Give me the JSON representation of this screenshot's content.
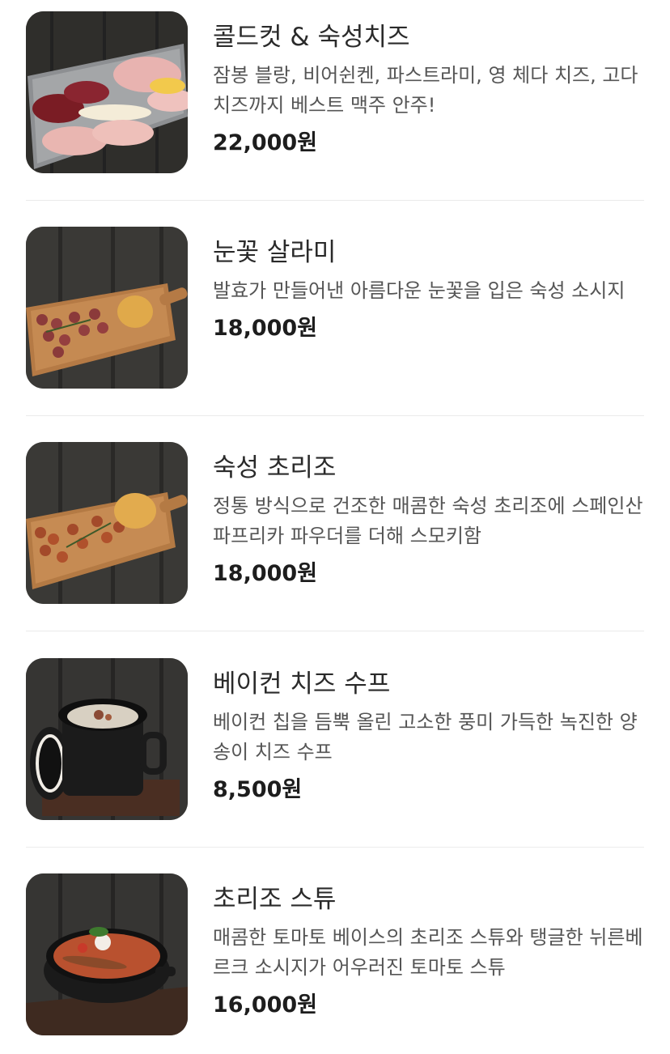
{
  "menu": {
    "items": [
      {
        "name": "콜드컷 & 숙성치즈",
        "description": "잠봉 블랑, 비어쉰켄, 파스트라미, 영 체다 치즈, 고다 치즈까지 베스트 맥주 안주!",
        "price": "22,000원",
        "image_icon": "cold-cut-platter-photo"
      },
      {
        "name": "눈꽃 살라미",
        "description": "발효가 만들어낸 아름다운 눈꽃을 입은 숙성 소시지",
        "price": "18,000원",
        "image_icon": "salami-board-photo"
      },
      {
        "name": "숙성 초리조",
        "description": "정통 방식으로 건조한 매콤한 숙성 초리조에 스페인산 파프리카 파우더를 더해 스모키함",
        "price": "18,000원",
        "image_icon": "chorizo-board-photo"
      },
      {
        "name": "베이컨 치즈 수프",
        "description": "베이컨 칩을 듬뿍 올린 고소한 풍미 가득한 녹진한 양송이 치즈 수프",
        "price": "8,500원",
        "image_icon": "soup-pot-photo"
      },
      {
        "name": "초리조 스튜",
        "description": "매콤한 토마토 베이스의 초리조 스튜와 탱글한 뉘른베르크 소시지가 어우러진 토마토 스튜",
        "price": "16,000원",
        "image_icon": "stew-pot-photo"
      }
    ]
  }
}
